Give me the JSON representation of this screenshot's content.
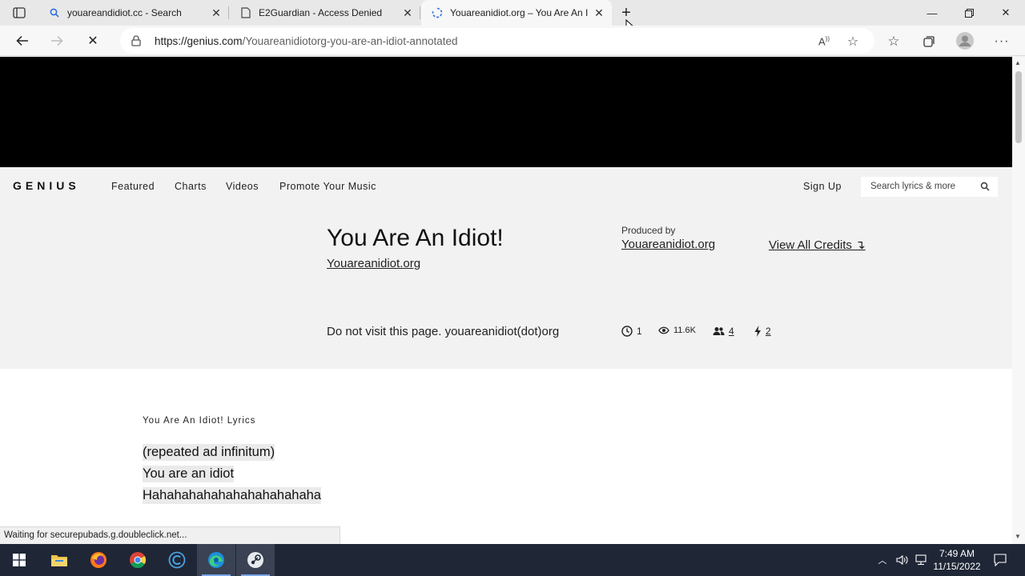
{
  "browser": {
    "tabs": [
      {
        "title": "youareandidiot.cc - Search",
        "active": false
      },
      {
        "title": "E2Guardian - Access Denied",
        "active": false
      },
      {
        "title": "Youareanidiot.org – You Are An I",
        "active": true
      }
    ],
    "url_host": "https://genius.com",
    "url_path": "/Youareanidiotorg-you-are-an-idiot-annotated",
    "status_text": "Waiting for securepubads.g.doubleclick.net..."
  },
  "site": {
    "logo": "GENIUS",
    "nav": [
      "Featured",
      "Charts",
      "Videos",
      "Promote Your Music"
    ],
    "sign_up": "Sign Up",
    "search_placeholder": "Search lyrics & more"
  },
  "song": {
    "title": "You Are An Idiot!",
    "artist": "Youareanidiot.org",
    "produced_by_label": "Produced by",
    "producer": "Youareanidiot.org",
    "credits_link": "View All Credits ↴",
    "description": "Do not visit this page. youareanidiot(dot)org",
    "stats": {
      "contributors_versions": "1",
      "views": "11.6K",
      "contributors": "4",
      "edits": "2"
    },
    "lyrics_header": "You Are An Idiot! Lyrics",
    "lyrics": [
      "(repeated ad infinitum)",
      "You are an idiot",
      "Hahahahahahahahahahahaha"
    ]
  },
  "taskbar": {
    "time": "7:49 AM",
    "date": "11/15/2022"
  },
  "colors": {
    "ad_banner": "#000000",
    "page_header_bg": "#f2f2f2",
    "taskbar": "#1f2636"
  }
}
